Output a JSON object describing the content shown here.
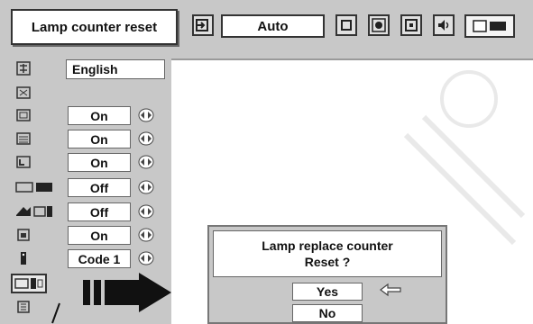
{
  "header": {
    "title": "Lamp counter reset",
    "source_value": "Auto",
    "icons": [
      "input-icon",
      "screen-icon",
      "image-adjust-icon",
      "position-icon",
      "sound-icon",
      "settings-icon"
    ]
  },
  "menu": {
    "language": "English",
    "rows": [
      {
        "icon": "blank-icon",
        "value": "On"
      },
      {
        "icon": "blue-back-icon",
        "value": "On"
      },
      {
        "icon": "display-icon",
        "value": "On"
      },
      {
        "icon": "logo-icon",
        "value": "Off"
      },
      {
        "icon": "power-management-icon",
        "value": "Off"
      },
      {
        "icon": "key-lock-icon",
        "value": "On"
      },
      {
        "icon": "remote-control-icon",
        "value": "Code 1"
      }
    ]
  },
  "dialog": {
    "message_line1": "Lamp replace counter",
    "message_line2": "Reset ?",
    "yes_label": "Yes",
    "no_label": "No"
  }
}
